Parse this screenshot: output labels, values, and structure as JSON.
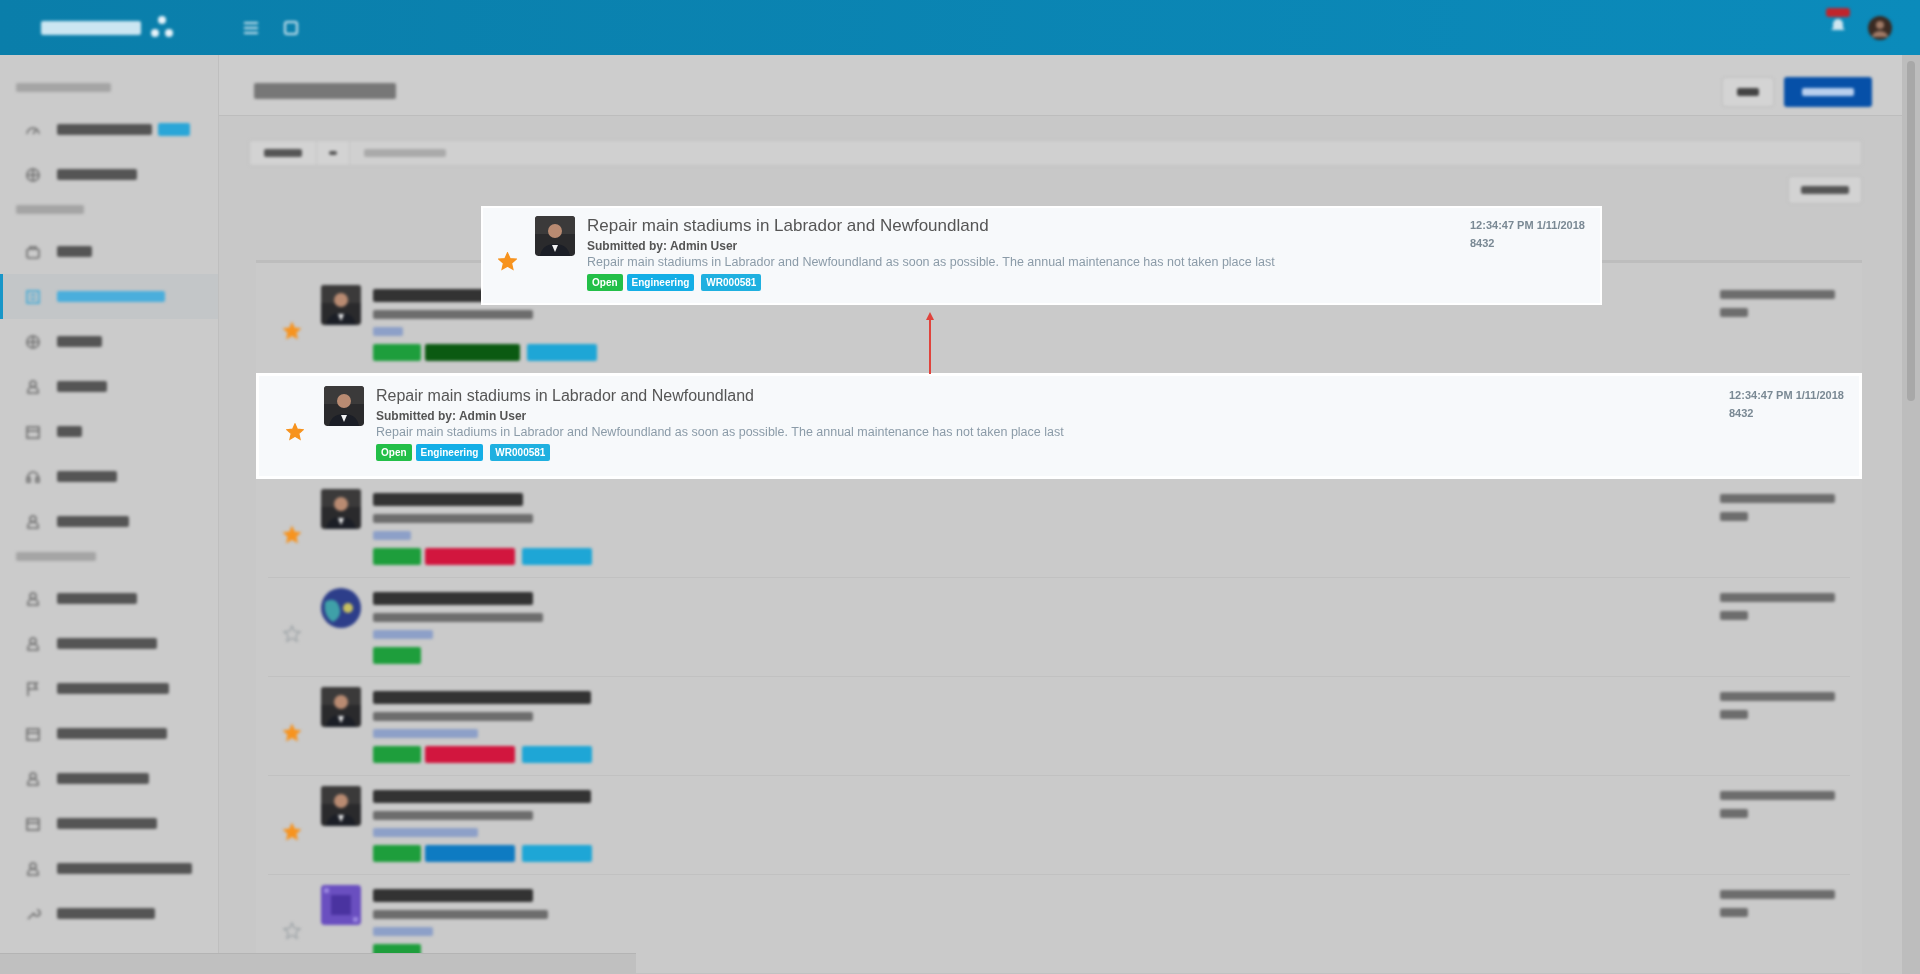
{
  "sidebar": {
    "sections": [
      {
        "items": [
          {
            "selected": false,
            "badge": true
          },
          {
            "selected": false,
            "badge": false
          }
        ]
      },
      {
        "items": [
          {
            "selected": false,
            "badge": false
          },
          {
            "selected": true,
            "badge": false
          },
          {
            "selected": false,
            "badge": false
          },
          {
            "selected": false,
            "badge": false
          },
          {
            "selected": false,
            "badge": false
          },
          {
            "selected": false,
            "badge": false
          },
          {
            "selected": false,
            "badge": false
          }
        ]
      },
      {
        "items": [
          {
            "selected": false,
            "badge": false
          },
          {
            "selected": false,
            "badge": false
          },
          {
            "selected": false,
            "badge": false
          },
          {
            "selected": false,
            "badge": false
          },
          {
            "selected": false,
            "badge": false
          },
          {
            "selected": false,
            "badge": false
          },
          {
            "selected": false,
            "badge": false
          },
          {
            "selected": false,
            "badge": false
          }
        ]
      }
    ]
  },
  "page": {
    "buttons": [
      {
        "kind": "plain"
      },
      {
        "kind": "primary"
      }
    ]
  },
  "requests": [
    {
      "starred": true,
      "tags": [
        {
          "color": "#1e9e3c"
        },
        {
          "color": "#0b5a12"
        },
        {
          "color": "#1ea6d6"
        }
      ],
      "highlighted": false
    },
    {
      "starred": true,
      "title": "Repair main stadiums in Labrador and Newfoundland",
      "submitted": "Submitted by: Admin User",
      "description": "Repair main stadiums in Labrador and Newfoundland as soon as possible. The annual maintenance has not taken place last",
      "tags": [
        {
          "label": "Open",
          "color": "#23bf48"
        },
        {
          "label": "Engineering",
          "color": "#14aee6"
        },
        {
          "label": "WR000581",
          "color": "#1fb0e0"
        }
      ],
      "time": "12:34:47 PM 1/11/2018",
      "number": "8432",
      "highlighted": true
    },
    {
      "starred": true,
      "tags": [
        {
          "color": "#1e9e3c"
        },
        {
          "color": "#d2163e"
        },
        {
          "color": "#1ea6d6"
        }
      ],
      "highlighted": false
    },
    {
      "starred": false,
      "avatar": {
        "kind": "globe"
      },
      "tags": [
        {
          "color": "#1e9e3c"
        }
      ],
      "highlighted": false
    },
    {
      "starred": true,
      "tags": [
        {
          "color": "#1e9e3c"
        },
        {
          "color": "#d2163e"
        },
        {
          "color": "#1ea6d6"
        }
      ],
      "highlighted": false
    },
    {
      "starred": true,
      "tags": [
        {
          "color": "#1e9e3c"
        },
        {
          "color": "#0e7bc2"
        },
        {
          "color": "#1ea6d6"
        }
      ],
      "highlighted": false
    },
    {
      "starred": false,
      "avatar": {
        "kind": "pattern"
      },
      "tags": [
        {
          "color": "#1e9e3c"
        }
      ],
      "highlighted": false
    }
  ],
  "callout": {
    "starred": true,
    "title": "Repair main stadiums in Labrador and Newfoundland",
    "submitted": "Submitted by: Admin User",
    "description": "Repair main stadiums in Labrador and Newfoundland as soon as possible. The annual maintenance has not taken place last",
    "tags": [
      {
        "label": "Open",
        "color": "#23bf48"
      },
      {
        "label": "Engineering",
        "color": "#14aee6"
      },
      {
        "label": "WR000581",
        "color": "#1fb0e0"
      }
    ],
    "time": "12:34:47 PM 1/11/2018",
    "number": "8432"
  }
}
